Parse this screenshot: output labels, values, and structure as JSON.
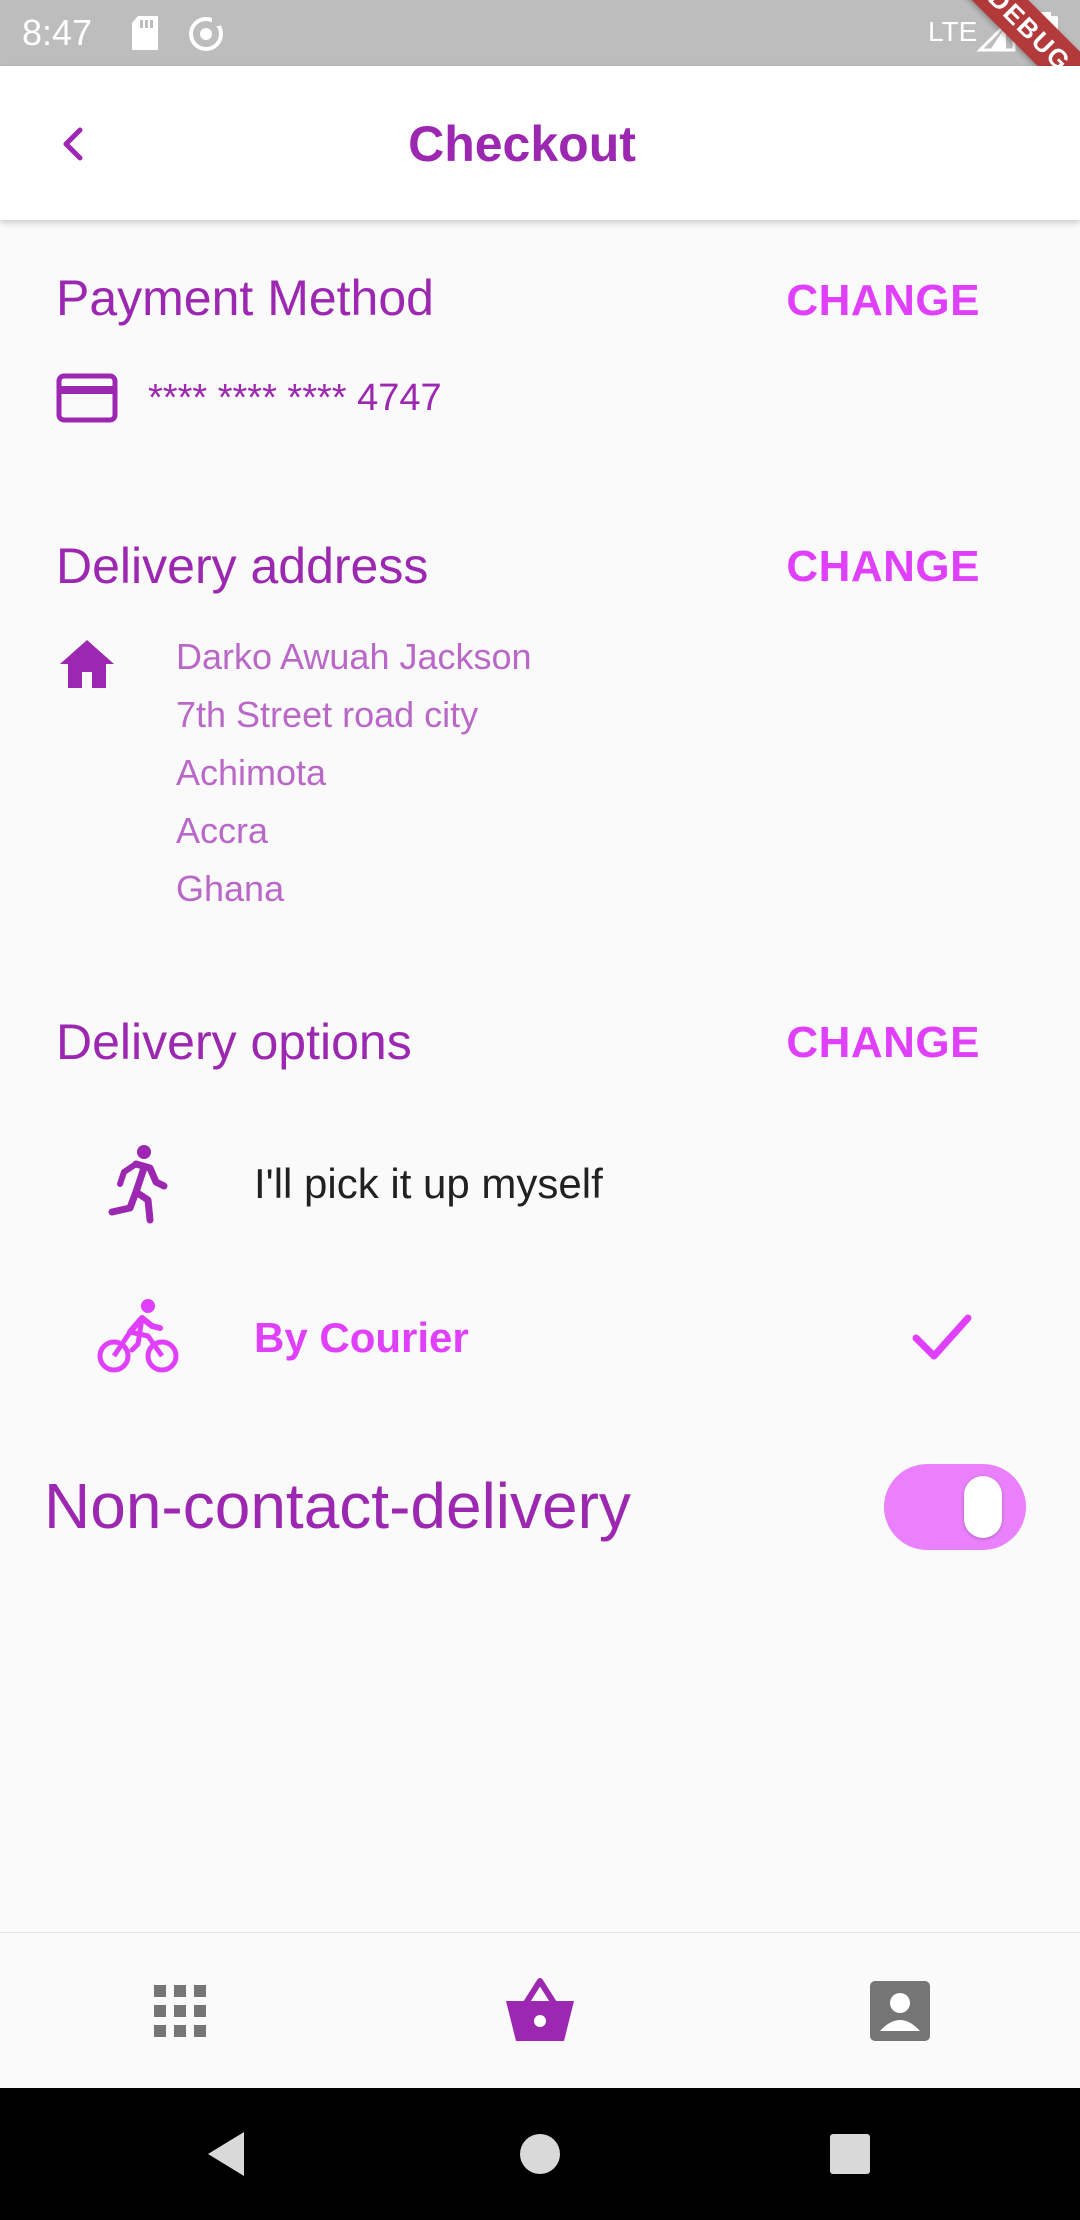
{
  "status_bar": {
    "time": "8:47",
    "network_label": "LTE",
    "icons": [
      "sd-card-icon",
      "sync-icon",
      "signal-icon",
      "battery-icon"
    ]
  },
  "debug_banner": "DEBUG",
  "app_bar": {
    "title": "Checkout",
    "back_icon": "chevron-left-icon"
  },
  "payment": {
    "title": "Payment Method",
    "change_label": "CHANGE",
    "icon": "credit-card-icon",
    "card_number": "**** **** **** 4747"
  },
  "delivery_address": {
    "title": "Delivery address",
    "change_label": "CHANGE",
    "icon": "home-icon",
    "lines": [
      "Darko Awuah Jackson",
      "7th Street road city",
      "Achimota",
      "Accra",
      "Ghana"
    ]
  },
  "delivery_options": {
    "title": "Delivery options",
    "change_label": "CHANGE",
    "options": [
      {
        "label": "I'll pick it up myself",
        "icon": "running-person-icon",
        "selected": false
      },
      {
        "label": "By Courier",
        "icon": "bicycle-icon",
        "selected": true
      }
    ]
  },
  "non_contact_delivery": {
    "label": "Non-contact-delivery",
    "enabled": true
  },
  "bottom_nav": {
    "items": [
      {
        "icon": "apps-grid-icon",
        "active": false
      },
      {
        "icon": "shopping-basket-icon",
        "active": true
      },
      {
        "icon": "account-box-icon",
        "active": false
      }
    ]
  },
  "colors": {
    "primary": "#9c27b0",
    "accent": "#e040fb",
    "address_text": "#ba68c8",
    "toggle_track": "#ea80fc",
    "nav_inactive": "#757575"
  }
}
